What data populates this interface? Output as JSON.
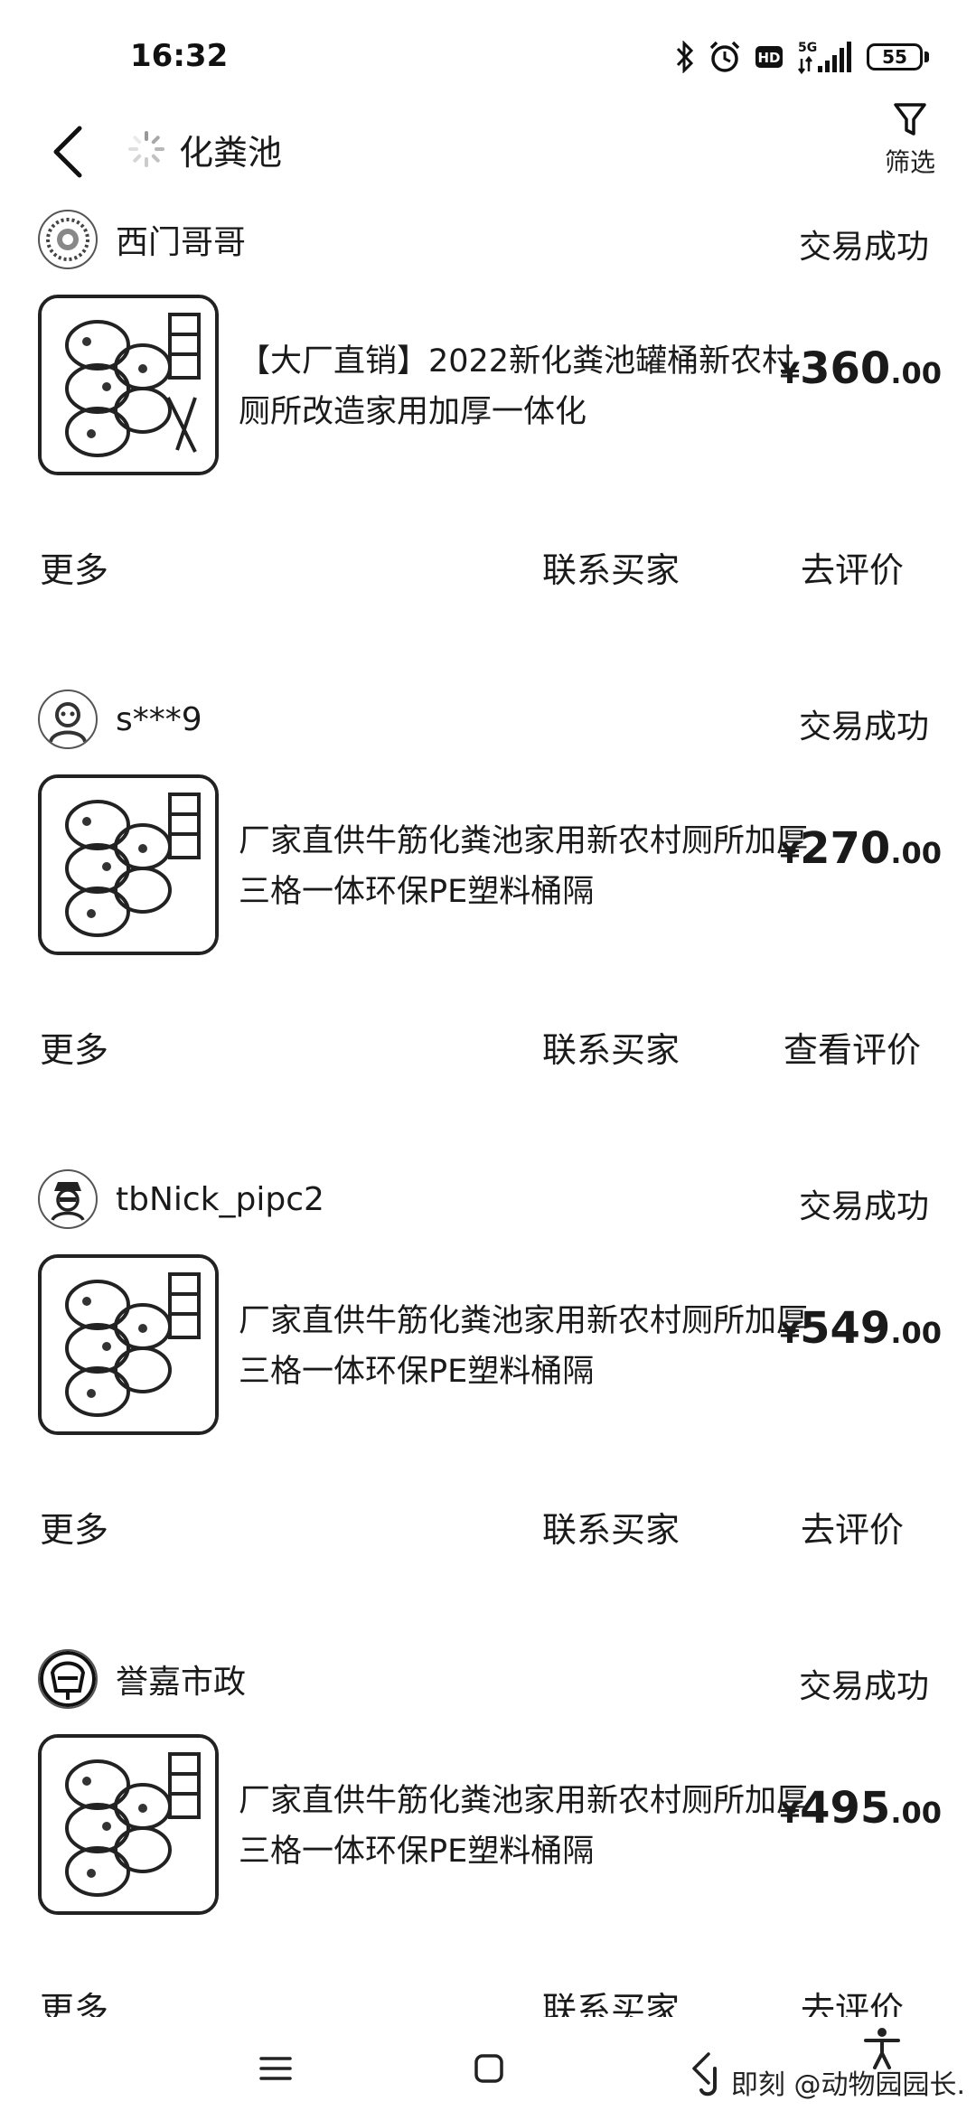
{
  "status_bar": {
    "time": "16:32",
    "network": "5G",
    "hd_label": "HD",
    "battery": "55"
  },
  "header": {
    "search_query": "化粪池",
    "filter_label": "筛选"
  },
  "orders": [
    {
      "seller": "西门哥哥",
      "status": "交易成功",
      "title": "【大厂直销】2022新化粪池罐桶新农村厕所改造家用加厚一体化",
      "price_currency": "¥",
      "price_int": "360",
      "price_dec": ".00",
      "more": "更多",
      "contact": "联系买家",
      "review": "去评价"
    },
    {
      "seller": "s***9",
      "status": "交易成功",
      "title": "厂家直供牛筋化粪池家用新农村厕所加厚三格一体环保PE塑料桶隔",
      "price_currency": "¥",
      "price_int": "270",
      "price_dec": ".00",
      "more": "更多",
      "contact": "联系买家",
      "review": "查看评价"
    },
    {
      "seller": "tbNick_pipc2",
      "status": "交易成功",
      "title": "厂家直供牛筋化粪池家用新农村厕所加厚三格一体环保PE塑料桶隔",
      "price_currency": "¥",
      "price_int": "549",
      "price_dec": ".00",
      "more": "更多",
      "contact": "联系买家",
      "review": "去评价"
    },
    {
      "seller": "誉嘉市政",
      "status": "交易成功",
      "title": "厂家直供牛筋化粪池家用新农村厕所加厚三格一体环保PE塑料桶隔",
      "price_currency": "¥",
      "price_int": "495",
      "price_dec": ".00",
      "more": "更多",
      "contact": "联系买家",
      "review": "去评价"
    }
  ],
  "nav_bar": {
    "watermark": "即刻 @动物园园长."
  },
  "colors": {
    "text": "#1a1a1a",
    "background": "#ffffff"
  }
}
